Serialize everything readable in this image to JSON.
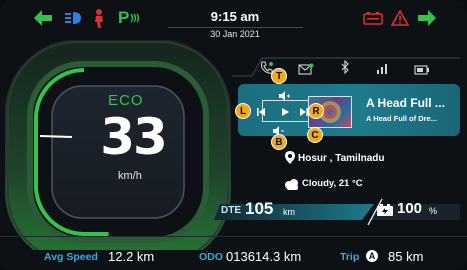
{
  "status_bar": {
    "time": "9:15 am",
    "date": "30 Jan 2021",
    "parking_label": "P"
  },
  "gauge": {
    "mode": "ECO",
    "speed": "33",
    "unit": "km/h"
  },
  "music": {
    "title": "A Head Full ...",
    "subtitle": "A Head Full of Dre...",
    "hints": {
      "top": "T",
      "left": "L",
      "right": "R",
      "center": "C",
      "bottom": "B"
    }
  },
  "location": "Hosur , Tamilnadu",
  "weather": "Cloudy, 21 °C",
  "dte": {
    "label": "DTE",
    "value": "105",
    "unit": "km"
  },
  "battery": {
    "value": "100",
    "unit": "%"
  },
  "footer": {
    "avg_label": "Avg Speed",
    "avg_value": "12.2 km",
    "odo_label": "ODO",
    "odo_value": "013614.3 km",
    "trip_label": "Trip",
    "trip_badge": "A",
    "trip_value": "85 km"
  },
  "colors": {
    "accent_green": "#35c24a",
    "accent_blue": "#3fa9d8",
    "warning_red": "#e03030",
    "hint_orange": "#f0a81e"
  }
}
